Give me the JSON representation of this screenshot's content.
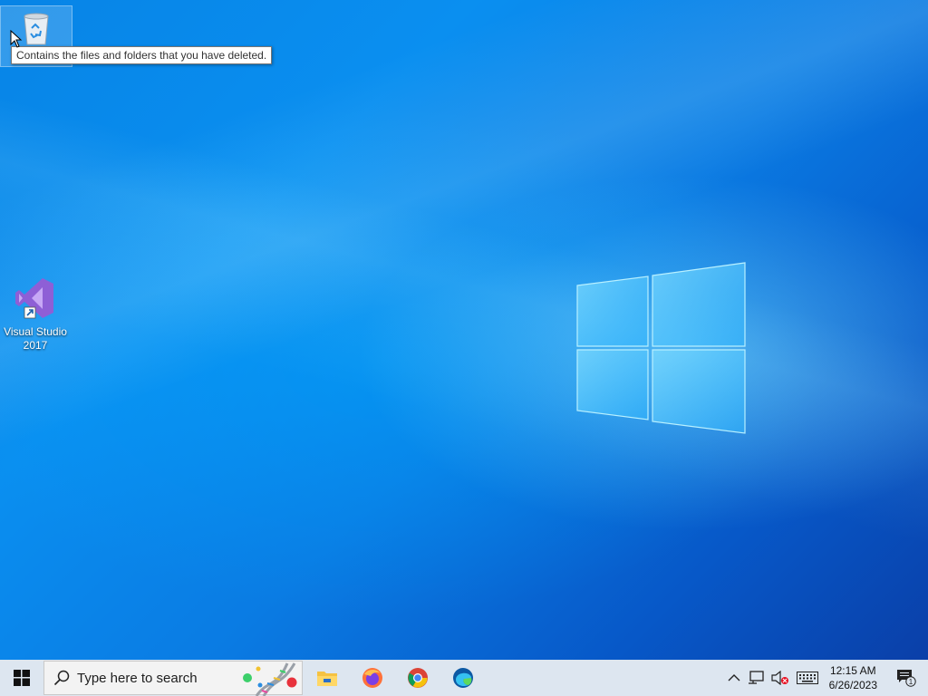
{
  "desktop": {
    "icons": [
      {
        "name": "Recycle Bin",
        "label": ""
      },
      {
        "name": "Visual Studio 2017",
        "label": "Visual Studio 2017"
      }
    ],
    "tooltip": "Contains the files and folders that you have deleted."
  },
  "taskbar": {
    "search_placeholder": "Type here to search",
    "pinned_apps": [
      "file-explorer-icon",
      "firefox-icon",
      "chrome-icon",
      "edge-icon"
    ],
    "clock": {
      "time": "12:15 AM",
      "date": "6/26/2023"
    },
    "notification_count": "1"
  },
  "colors": {
    "wallpaper_accent": "#0a8ff0",
    "taskbar_bg": "#dde6f0"
  }
}
